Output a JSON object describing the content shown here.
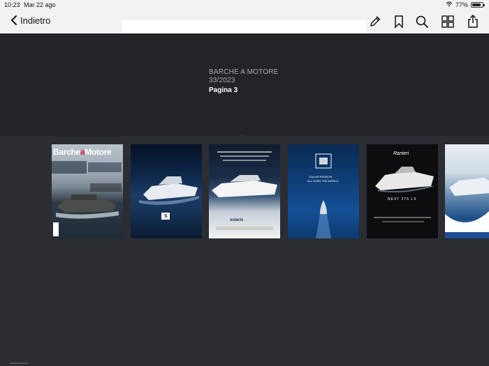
{
  "status_bar": {
    "time": "10:23",
    "date": "Mar 22 ago",
    "battery_text": "77%",
    "battery_level": 0.77
  },
  "toolbar": {
    "back_label": "Indietro",
    "icons": [
      "edit-icon",
      "bookmark-icon",
      "search-icon",
      "thumbnails-icon",
      "share-icon"
    ]
  },
  "issue": {
    "magazine": "BARCHE A MOTORE",
    "number": "33/2023",
    "page_label": "Pagina 3"
  },
  "thumbnails": [
    {
      "title_a": "Barche",
      "title_b": "a",
      "title_c": "Motore"
    },
    {
      "logo": "S"
    },
    {
      "brand": "solaris"
    },
    {
      "tagline_1": "ITALIAN PASSION",
      "tagline_2": "ALL OVER THE WORLD"
    },
    {
      "brand": "Ranieri",
      "model": "NEXT 275 LX"
    },
    {}
  ],
  "colors": {
    "toolbar_bg": "#f2f2f2",
    "header_bg": "#232428",
    "strip_bg": "#2b2d33"
  }
}
